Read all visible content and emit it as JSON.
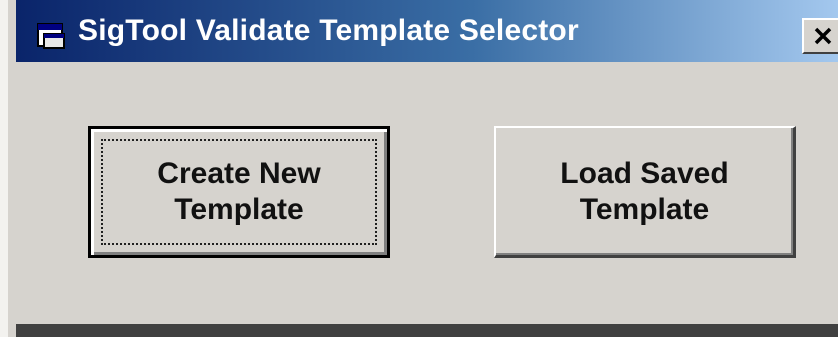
{
  "window": {
    "title": "SigTool Validate Template Selector",
    "icon": "app-window-icon",
    "close_label": "close-icon"
  },
  "buttons": {
    "create_label": "Create New\nTemplate",
    "load_label": "Load Saved\nTemplate"
  },
  "colors": {
    "title_gradient_start": "#0a246a",
    "title_gradient_end": "#a6caf0",
    "face": "#d6d3ce"
  }
}
